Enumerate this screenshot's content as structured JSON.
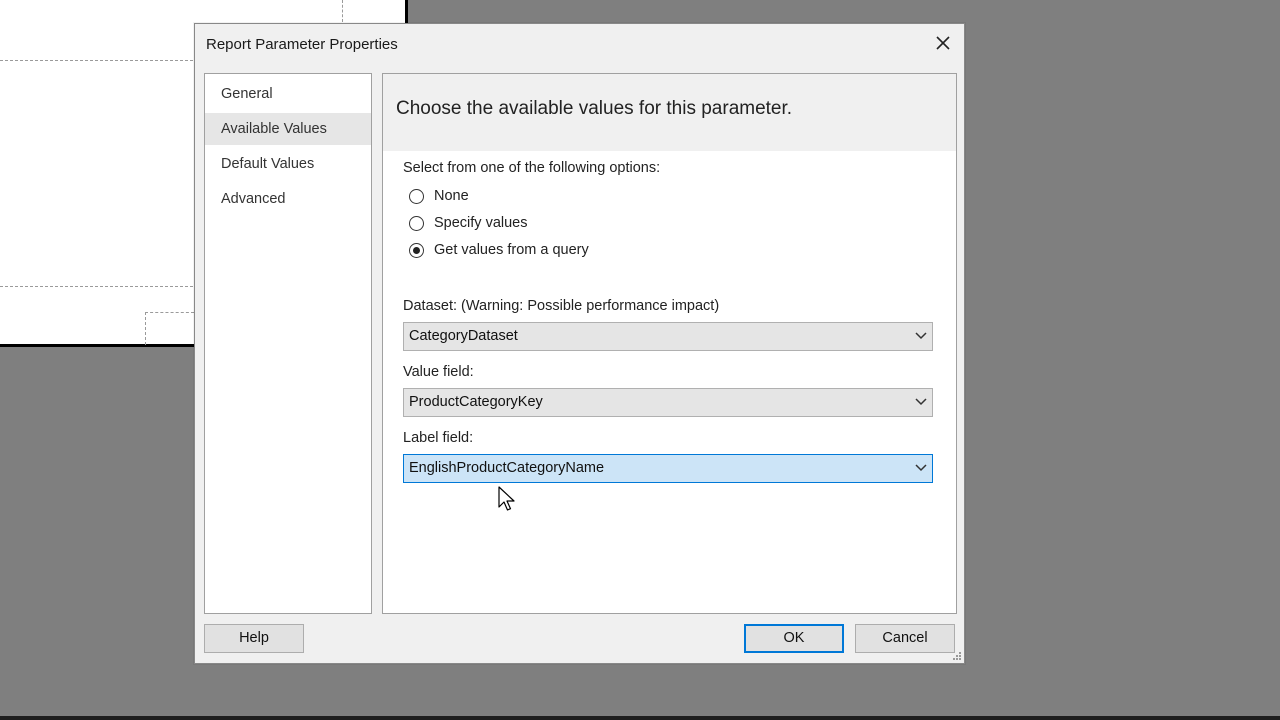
{
  "dialog": {
    "title": "Report Parameter Properties",
    "nav": [
      {
        "label": "General",
        "selected": false
      },
      {
        "label": "Available Values",
        "selected": true
      },
      {
        "label": "Default Values",
        "selected": false
      },
      {
        "label": "Advanced",
        "selected": false
      }
    ],
    "content": {
      "heading": "Choose the available values for this parameter.",
      "options_label": "Select from one of the following options:",
      "options": [
        {
          "label": "None",
          "checked": false
        },
        {
          "label": "Specify values",
          "checked": false
        },
        {
          "label": "Get values from a query",
          "checked": true
        }
      ],
      "dataset": {
        "label": "Dataset: (Warning: Possible performance impact)",
        "value": "CategoryDataset"
      },
      "value_field": {
        "label": "Value field:",
        "value": "ProductCategoryKey"
      },
      "label_field": {
        "label": "Label field:",
        "value": "EnglishProductCategoryName",
        "focused": true
      }
    },
    "buttons": {
      "help": "Help",
      "ok": "OK",
      "cancel": "Cancel"
    }
  },
  "colors": {
    "accent": "#0078d7",
    "focus_fill": "#cce4f7",
    "backdrop": "#7f7f7f"
  }
}
